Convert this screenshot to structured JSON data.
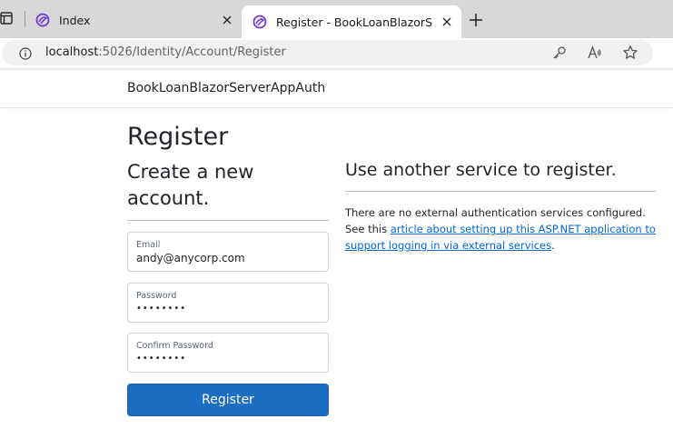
{
  "browser": {
    "tabs": [
      {
        "title": "Index",
        "active": false
      },
      {
        "title": "Register - BookLoanBlazorServerAppAuth",
        "active": true
      }
    ],
    "address": {
      "host": "localhost",
      "path": ":5026/Identity/Account/Register"
    },
    "icons": {
      "tab_actions": "tab-actions-icon",
      "favicon": "blazor-favicon",
      "close": "close-icon",
      "new_tab": "plus-icon",
      "site_info": "info-icon",
      "password_key": "key-icon",
      "read_aloud": "read-aloud-icon",
      "favorite": "star-icon"
    }
  },
  "site": {
    "brand": "BookLoanBlazorServerAppAuth"
  },
  "register": {
    "title": "Register",
    "subtitle": "Create a new account.",
    "email": {
      "label": "Email",
      "value": "andy@anycorp.com"
    },
    "password": {
      "label": "Password",
      "value": "••••••••"
    },
    "confirm_password": {
      "label": "Confirm Password",
      "value": "••••••••"
    },
    "submit_label": "Register"
  },
  "external": {
    "title": "Use another service to register.",
    "text_before": "There are no external authentication services configured. See this ",
    "link_text": "article about setting up this ASP.NET application to support logging in via external services",
    "text_after": "."
  },
  "colors": {
    "primary_button": "#1b6ec2",
    "link": "#0366d6",
    "tabstrip": "#d8d8d8"
  }
}
